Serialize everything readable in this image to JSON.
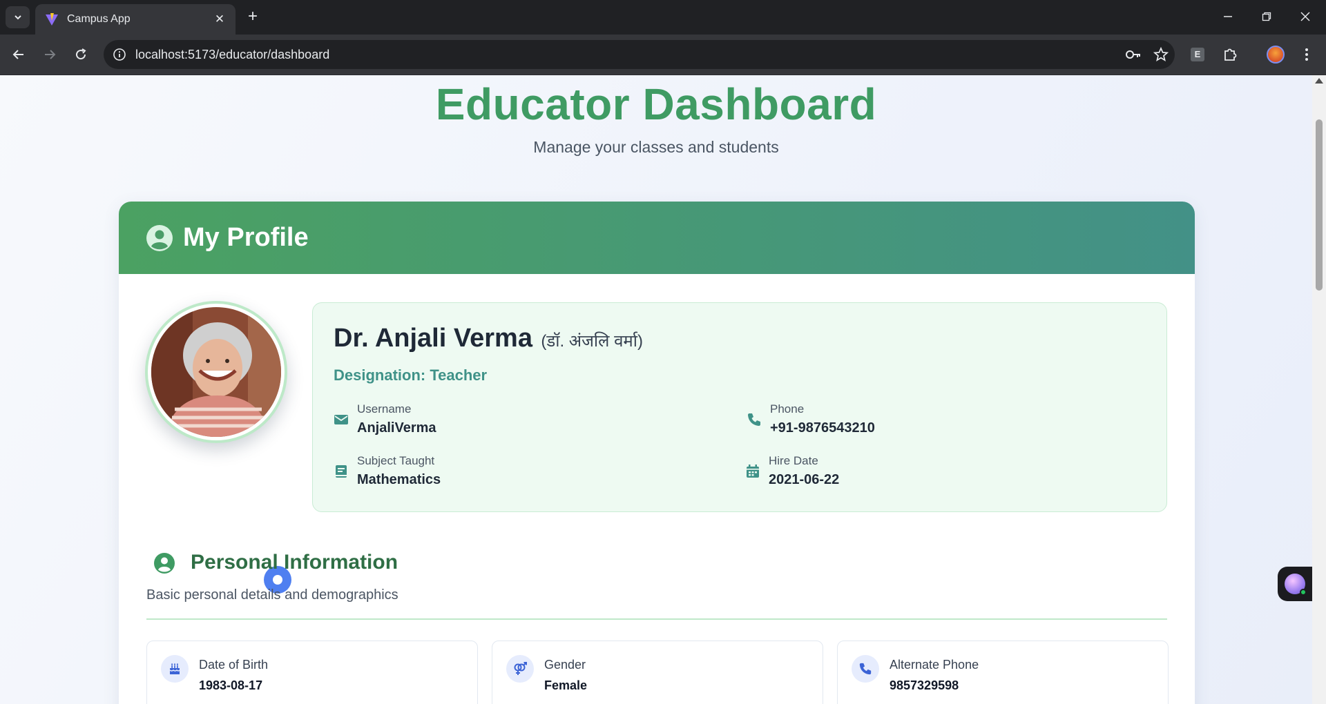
{
  "browser": {
    "tab_title": "Campus App",
    "url": "localhost:5173/educator/dashboard",
    "extension_letter": "E"
  },
  "page": {
    "title": "Educator Dashboard",
    "subtitle": "Manage your classes and students"
  },
  "profile": {
    "header": "My Profile",
    "name": "Dr. Anjali Verma",
    "name_hindi": "(डॉ. अंजलि वर्मा)",
    "designation": "Designation: Teacher",
    "fields": {
      "username": {
        "label": "Username",
        "value": "AnjaliVerma"
      },
      "phone": {
        "label": "Phone",
        "value": "+91-9876543210"
      },
      "subject": {
        "label": "Subject Taught",
        "value": "Mathematics"
      },
      "hire_date": {
        "label": "Hire Date",
        "value": "2021-06-22"
      }
    }
  },
  "personal_info": {
    "title": "Personal Information",
    "subtitle": "Basic personal details and demographics",
    "tiles": [
      {
        "label": "Date of Birth",
        "value": "1983-08-17",
        "icon": "cake-icon"
      },
      {
        "label": "Gender",
        "value": "Female",
        "icon": "gender-icon"
      },
      {
        "label": "Alternate Phone",
        "value": "9857329598",
        "icon": "phone-icon"
      }
    ]
  },
  "colors": {
    "accent_green": "#3f9b63",
    "header_gradient_start": "#4ba162",
    "header_gradient_end": "#439187",
    "teal": "#3f9288",
    "blue_button": "#4f7ff0"
  }
}
